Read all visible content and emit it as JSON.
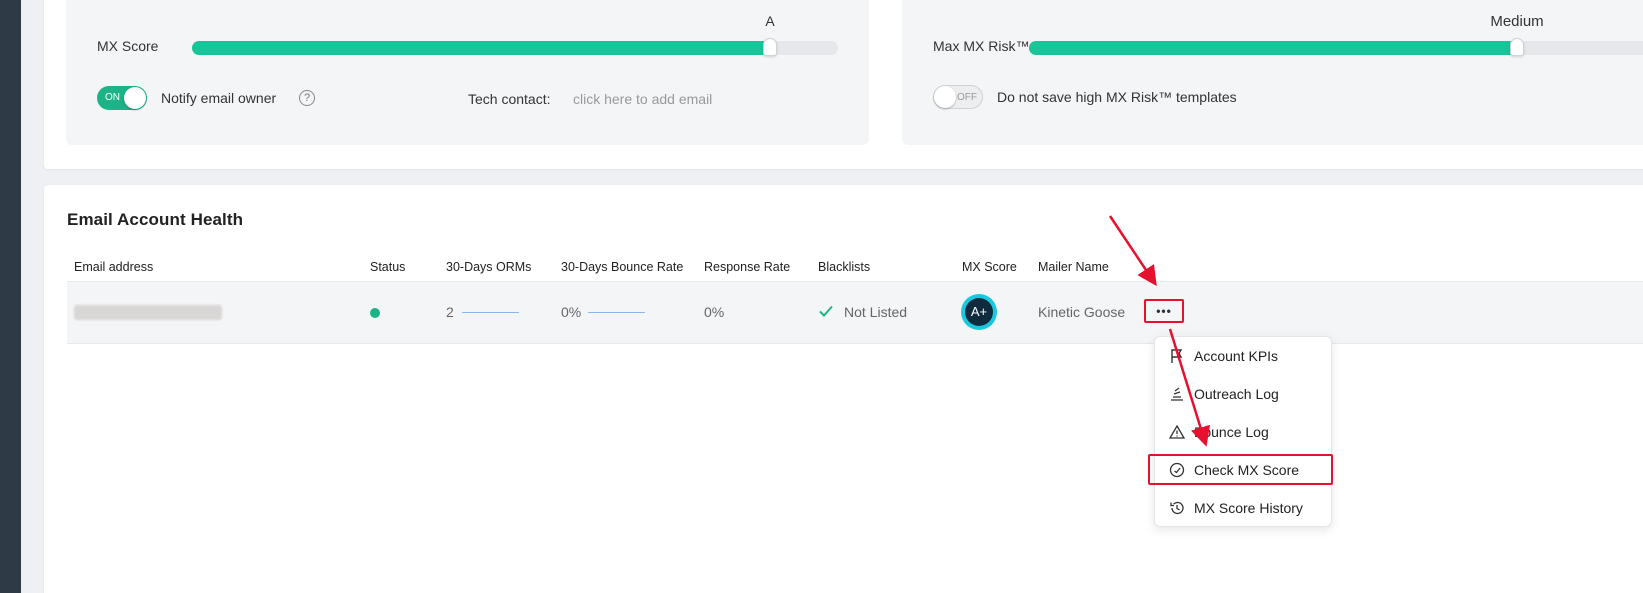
{
  "score_panel": {
    "label": "MX Score",
    "grade": "A",
    "level": 0.895,
    "notify_toggle": "ON",
    "notify_label": "Notify email owner",
    "help_glyph": "?",
    "tech_contact_label": "Tech contact:",
    "tech_contact_placeholder": "click here to add email"
  },
  "risk_panel": {
    "label": "Max MX Risk™",
    "level_label": "Medium",
    "level": 0.74,
    "save_toggle": "OFF",
    "save_label": "Do not save high MX Risk™ templates"
  },
  "health": {
    "title": "Email Account Health",
    "columns": [
      "Email address",
      "Status",
      "30-Days ORMs",
      "30-Days Bounce Rate",
      "Response Rate",
      "Blacklists",
      "MX Score",
      "Mailer Name"
    ],
    "row": {
      "orms": "2",
      "bounce_rate": "0%",
      "response_rate": "0%",
      "blacklist": "Not Listed",
      "mx_grade": "A+",
      "mailer_name": "Kinetic Goose",
      "more_glyph": "•••"
    }
  },
  "menu": {
    "items": [
      {
        "label": "Account KPIs",
        "icon": "flag-icon"
      },
      {
        "label": "Outreach Log",
        "icon": "log-icon"
      },
      {
        "label": "Bounce Log",
        "icon": "warning-icon"
      },
      {
        "label": "Check MX Score",
        "icon": "gauge-icon"
      },
      {
        "label": "MX Score History",
        "icon": "history-icon"
      }
    ]
  },
  "colors": {
    "accent": "#17c59a",
    "annotation": "#e8102f",
    "rail": "#2e3a45"
  }
}
